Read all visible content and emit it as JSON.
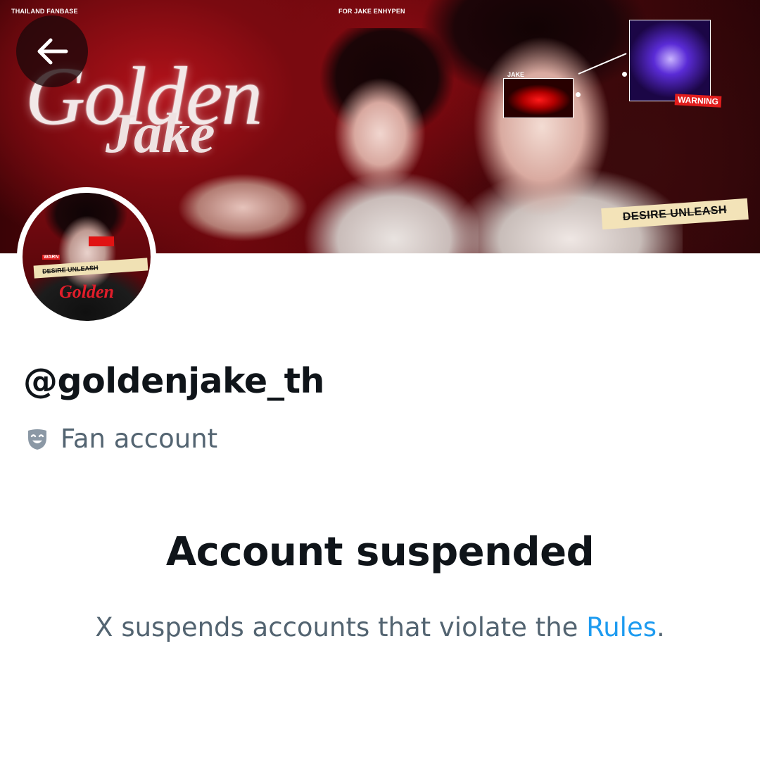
{
  "banner": {
    "left_label": "THAILAND FANBASE",
    "center_label": "FOR JAKE ENHYPEN",
    "logo_line1": "Golden",
    "logo_line2": "Jake",
    "thumb_label": "JAKE",
    "warning_label": "WARNING",
    "tape_text": "DESIRE UNLEASH"
  },
  "avatar": {
    "warning_label": "WARN",
    "tape_text": "DESIRE UNLEASH",
    "logo_text": "Golden"
  },
  "profile": {
    "handle": "@goldenjake_th",
    "account_type": "Fan account",
    "account_type_icon": "theater-mask-icon"
  },
  "suspension": {
    "title": "Account suspended",
    "desc_prefix": "X suspends accounts that violate the ",
    "rules_link": "Rules",
    "desc_suffix": "."
  },
  "colors": {
    "text_primary": "#0f1419",
    "text_secondary": "#536471",
    "link": "#1d9bf0"
  }
}
